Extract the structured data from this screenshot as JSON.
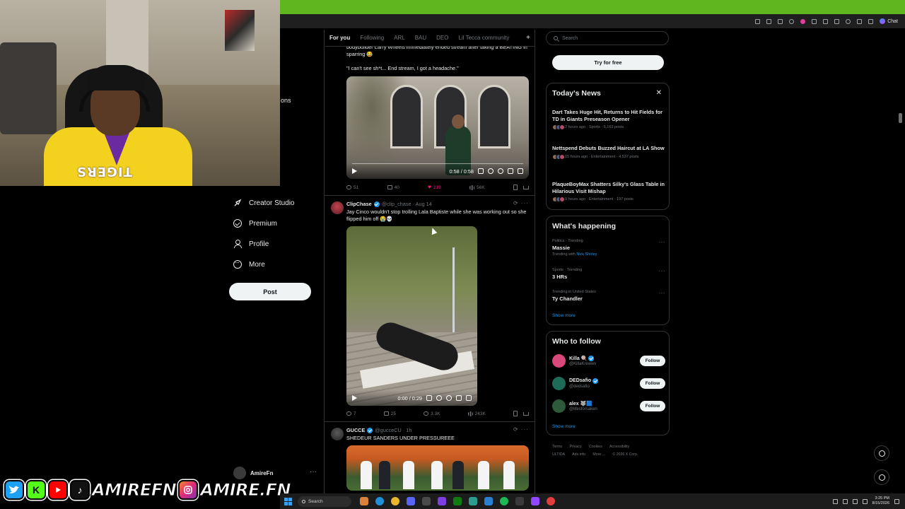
{
  "browser": {
    "chat_label": "Chat"
  },
  "webcam": {
    "jersey_text": "TIGERS",
    "stray_text": "ons"
  },
  "nav": {
    "items": [
      {
        "label": "Creator Studio",
        "icon": "rocket-icon"
      },
      {
        "label": "Premium",
        "icon": "verified-circle-icon"
      },
      {
        "label": "Profile",
        "icon": "person-icon"
      },
      {
        "label": "More",
        "icon": "more-circle-icon"
      }
    ],
    "post_label": "Post",
    "account_name": "AmireFn"
  },
  "banner": {
    "handle1": "AMIREFN",
    "handle2": "AMIRE.FN"
  },
  "feed": {
    "tabs": [
      "For you",
      "Following",
      "ARL",
      "BAU",
      "DEO",
      "Lil Tecca community"
    ],
    "active_tab": "For you",
    "add_tab": "+",
    "post1": {
      "text_top": "bodybuilder Larry Wheels immediately ended stream after taking a BEATING in sparring 😂",
      "quote": "\"I can't see sh*t... End stream, I got a headache.\"",
      "video_time": "0:58 / 0:58",
      "replies": "51",
      "reposts": "40",
      "likes": "219",
      "views": "56K"
    },
    "post2": {
      "name": "ClipChase",
      "handle": "@clip_chase · Aug 14",
      "text": "Jay Cinco wouldn't stop trolling Lala Baptiste while she was working out so she flipped him off 😭💀",
      "video_time": "0:00 / 0:29",
      "replies": "7",
      "reposts": "25",
      "likes": "3.3K",
      "views": "243K"
    },
    "post3": {
      "name": "GUCCE",
      "handle": "@gucceCU · 1h",
      "text": "SHEDEUR SANDERS UNDER PRESSUREEE"
    }
  },
  "sidebar": {
    "search_placeholder": "Search",
    "try_label": "Try for free",
    "todays_news": {
      "title": "Today's News",
      "items": [
        {
          "title": "Dart Takes Huge Hit, Returns to Hit Fields for TD in Giants Preseason Opener",
          "meta": "2 hours ago · Sports · 6,163 posts"
        },
        {
          "title": "Nettspend Debuts Buzzed Haircut at LA Show",
          "meta": "15 hours ago · Entertainment · 4,537 posts"
        },
        {
          "title": "PlaqueBoyMax Shatters Silky's Glass Table in Hilarious Visit Mishap",
          "meta": "9 hours ago · Entertainment · 197 posts"
        }
      ]
    },
    "whats_happening": {
      "title": "What's happening",
      "trends": [
        {
          "context": "Politics · Trending",
          "title": "Massie",
          "sub_prefix": "Trending with",
          "sub_link": "Nick Shirley"
        },
        {
          "context": "Sports · Trending",
          "title": "3 HRs",
          "sub_prefix": "",
          "sub_link": ""
        },
        {
          "context": "Trending in United States",
          "title": "Ty Chandler",
          "sub_prefix": "",
          "sub_link": ""
        }
      ],
      "show_more": "Show more"
    },
    "who_to_follow": {
      "title": "Who to follow",
      "accounts": [
        {
          "name": "Killa 🍭",
          "handle": "@KillaKrewwv",
          "avatar_color": "#d9487a"
        },
        {
          "name": "DEDsafio",
          "handle": "@dedsafio",
          "avatar_color": "#1f6b5a"
        },
        {
          "name": "alex 🐺🟦",
          "handle": "@lifesforsaken",
          "avatar_color": "#2c5a3a"
        }
      ],
      "follow_label": "Follow",
      "show_more": "Show more"
    },
    "footer": {
      "links": [
        "Terms",
        "Privacy",
        "Cookies",
        "Accessibility",
        "ULTIDA",
        "Ads info",
        "More ...",
        "© 2026 X Corp."
      ]
    }
  },
  "taskbar": {
    "search_label": "Search",
    "time": "3:25 PM",
    "date": "8/15/2026"
  },
  "colors": {
    "accent": "#1d9bf0",
    "titlebar": "#5fb61f",
    "like": "#f91880"
  }
}
